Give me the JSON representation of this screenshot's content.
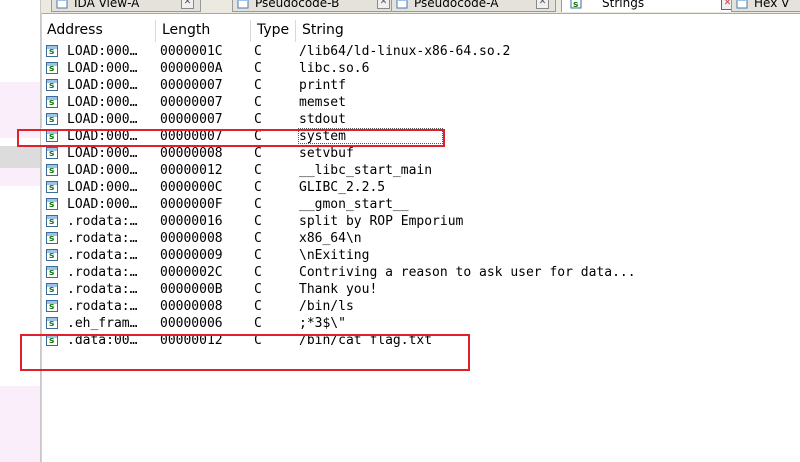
{
  "tabs": [
    {
      "label": "IDA View-A",
      "icon": "ida-view-icon",
      "active": false
    },
    {
      "label": "Pseudocode-B",
      "icon": "pseudocode-icon",
      "active": false
    },
    {
      "label": "Pseudocode-A",
      "icon": "pseudocode-icon",
      "active": false
    },
    {
      "label": "Strings",
      "icon": "strings-icon",
      "active": true
    },
    {
      "label": "Hex V",
      "icon": "hex-view-icon",
      "active": false
    }
  ],
  "columns": {
    "address": "Address",
    "length": "Length",
    "type": "Type",
    "string": "String"
  },
  "rows": [
    {
      "address": "LOAD:000…",
      "length": "0000001C",
      "type": "C",
      "string": "/lib64/ld-linux-x86-64.so.2"
    },
    {
      "address": "LOAD:000…",
      "length": "0000000A",
      "type": "C",
      "string": "libc.so.6"
    },
    {
      "address": "LOAD:000…",
      "length": "00000007",
      "type": "C",
      "string": "printf"
    },
    {
      "address": "LOAD:000…",
      "length": "00000007",
      "type": "C",
      "string": "memset"
    },
    {
      "address": "LOAD:000…",
      "length": "00000007",
      "type": "C",
      "string": "stdout"
    },
    {
      "address": "LOAD:000…",
      "length": "00000007",
      "type": "C",
      "string": "system"
    },
    {
      "address": "LOAD:000…",
      "length": "00000008",
      "type": "C",
      "string": "setvbuf"
    },
    {
      "address": "LOAD:000…",
      "length": "00000012",
      "type": "C",
      "string": "__libc_start_main"
    },
    {
      "address": "LOAD:000…",
      "length": "0000000C",
      "type": "C",
      "string": "GLIBC_2.2.5"
    },
    {
      "address": "LOAD:000…",
      "length": "0000000F",
      "type": "C",
      "string": "__gmon_start__"
    },
    {
      "address": ".rodata:…",
      "length": "00000016",
      "type": "C",
      "string": "split by ROP Emporium"
    },
    {
      "address": ".rodata:…",
      "length": "00000008",
      "type": "C",
      "string": "x86_64\\n"
    },
    {
      "address": ".rodata:…",
      "length": "00000009",
      "type": "C",
      "string": "\\nExiting"
    },
    {
      "address": ".rodata:…",
      "length": "0000002C",
      "type": "C",
      "string": "Contriving a reason to ask user for data..."
    },
    {
      "address": ".rodata:…",
      "length": "0000000B",
      "type": "C",
      "string": "Thank you!"
    },
    {
      "address": ".rodata:…",
      "length": "00000008",
      "type": "C",
      "string": "/bin/ls"
    },
    {
      "address": ".eh_fram…",
      "length": "00000006",
      "type": "C",
      "string": ";*3$\\\""
    },
    {
      "address": ".data:00…",
      "length": "00000012",
      "type": "C",
      "string": "/bin/cat flag.txt"
    }
  ],
  "row_icon": "string-item-icon",
  "highlight_color": "#e0202a"
}
